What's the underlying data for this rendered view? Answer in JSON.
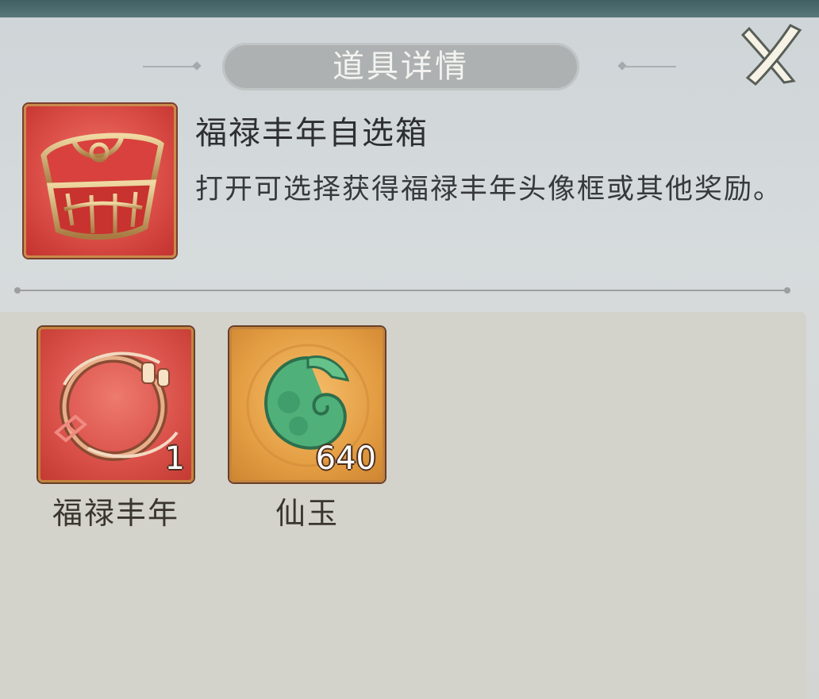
{
  "header": {
    "title": "道具详情"
  },
  "item": {
    "name": "福禄丰年自选箱",
    "description": "打开可选择获得福禄丰年头像框或其他奖励。",
    "icon": "treasure-chest-icon"
  },
  "rewards": [
    {
      "label": "福禄丰年",
      "count": "1",
      "icon": "avatar-frame-icon",
      "color": "#d95049"
    },
    {
      "label": "仙玉",
      "count": "640",
      "icon": "jade-dragon-icon",
      "color": "#e49e43"
    }
  ],
  "close": {
    "icon": "close-icon"
  }
}
